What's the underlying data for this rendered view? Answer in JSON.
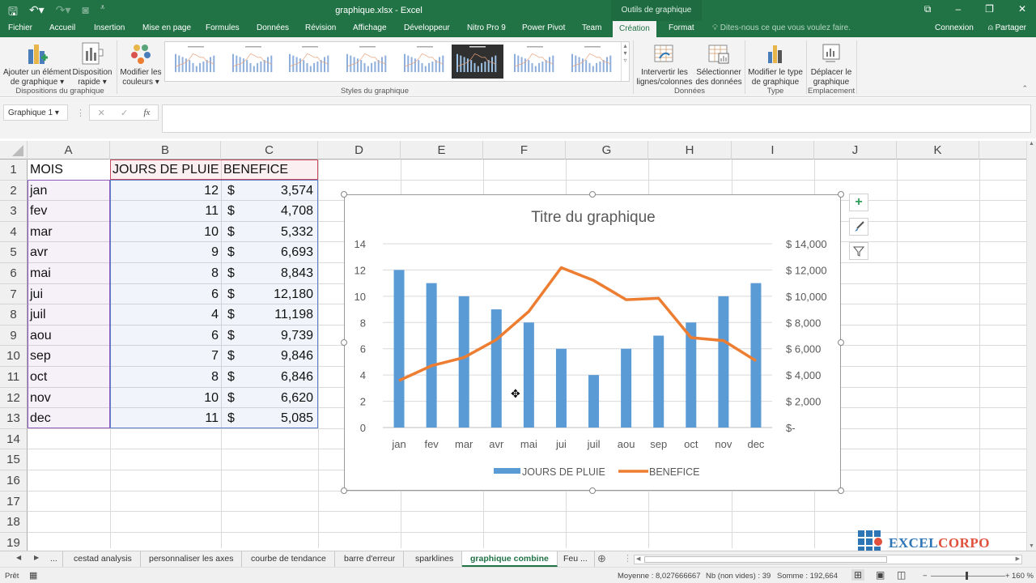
{
  "window": {
    "title": "graphique.xlsx - Excel",
    "context_group": "Outils de graphique"
  },
  "ribbon_tabs": [
    "Fichier",
    "Accueil",
    "Insertion",
    "Mise en page",
    "Formules",
    "Données",
    "Révision",
    "Affichage",
    "Développeur",
    "Nitro Pro 9",
    "Power Pivot",
    "Team",
    "Création",
    "Format"
  ],
  "active_tab": "Création",
  "tell_me": "Dites-nous ce que vous voulez faire.",
  "account": {
    "signin": "Connexion",
    "share": "Partager"
  },
  "ribbon": {
    "add_element": [
      "Ajouter un élément",
      "de graphique ▾"
    ],
    "quick_layout": [
      "Disposition",
      "rapide ▾"
    ],
    "change_colors": [
      "Modifier les",
      "couleurs ▾"
    ],
    "switch_row_col": [
      "Intervertir les",
      "lignes/colonnes"
    ],
    "select_data": [
      "Sélectionner",
      "des données"
    ],
    "change_type": [
      "Modifier le type",
      "de graphique"
    ],
    "move_chart": [
      "Déplacer le",
      "graphique"
    ],
    "groups": {
      "layouts": "Dispositions du graphique",
      "styles": "Styles du graphique",
      "data": "Données",
      "type": "Type",
      "location": "Emplacement"
    },
    "style_count": 8,
    "selected_style_index": 5
  },
  "formula_bar": {
    "name_box": "Graphique 1 ▾",
    "cancel": "✕",
    "enter": "✓",
    "fx": "fx",
    "value": ""
  },
  "columns": [
    "A",
    "B",
    "C",
    "D",
    "E",
    "F",
    "G",
    "H",
    "I",
    "J",
    "K"
  ],
  "rows": [
    "1",
    "2",
    "3",
    "4",
    "5",
    "6",
    "7",
    "8",
    "9",
    "10",
    "11",
    "12",
    "13",
    "14",
    "15",
    "16",
    "17",
    "18",
    "19"
  ],
  "sheet": {
    "headers": [
      "MOIS",
      "JOURS DE PLUIE",
      "BENEFICE"
    ],
    "data": [
      [
        "jan",
        "12",
        "$",
        "3,574"
      ],
      [
        "fev",
        "11",
        "$",
        "4,708"
      ],
      [
        "mar",
        "10",
        "$",
        "5,332"
      ],
      [
        "avr",
        "9",
        "$",
        "6,693"
      ],
      [
        "mai",
        "8",
        "$",
        "8,843"
      ],
      [
        "jui",
        "6",
        "$",
        "12,180"
      ],
      [
        "juil",
        "4",
        "$",
        "11,198"
      ],
      [
        "aou",
        "6",
        "$",
        "9,739"
      ],
      [
        "sep",
        "7",
        "$",
        "9,846"
      ],
      [
        "oct",
        "8",
        "$",
        "6,846"
      ],
      [
        "nov",
        "10",
        "$",
        "6,620"
      ],
      [
        "dec",
        "11",
        "$",
        "5,085"
      ]
    ]
  },
  "chart_data": {
    "type": "bar+line",
    "title": "Titre du graphique",
    "categories": [
      "jan",
      "fev",
      "mar",
      "avr",
      "mai",
      "jui",
      "juil",
      "aou",
      "sep",
      "oct",
      "nov",
      "dec"
    ],
    "series": [
      {
        "name": "JOURS DE PLUIE",
        "type": "bar",
        "axis": "left",
        "color": "#5b9bd5",
        "values": [
          12,
          11,
          10,
          9,
          8,
          6,
          4,
          6,
          7,
          8,
          10,
          11
        ]
      },
      {
        "name": "BENEFICE",
        "type": "line",
        "axis": "right",
        "color": "#ed7d31",
        "values": [
          3574,
          4708,
          5332,
          6693,
          8843,
          12180,
          11198,
          9739,
          9846,
          6846,
          6620,
          5085
        ]
      }
    ],
    "y_left": {
      "min": 0,
      "max": 14,
      "step": 2,
      "ticks": [
        "0",
        "2",
        "4",
        "6",
        "8",
        "10",
        "12",
        "14"
      ]
    },
    "y_right": {
      "min": 0,
      "max": 14000,
      "step": 2000,
      "ticks": [
        "$-",
        "$ 2,000",
        "$ 4,000",
        "$ 6,000",
        "$ 8,000",
        "$ 10,000",
        "$ 12,000",
        "$ 14,000"
      ]
    },
    "grid": true,
    "legend": "bottom"
  },
  "chart_side_buttons": [
    "chart-elements",
    "chart-styles",
    "chart-filters"
  ],
  "sheet_tabs": [
    "cestad analysis",
    "personnaliser les axes",
    "courbe de tendance",
    "barre d'erreur",
    "sparklines",
    "graphique combine",
    "Feu ..."
  ],
  "active_sheet": "graphique combine",
  "status": {
    "ready": "Prêt",
    "average": "Moyenne : 8,027666667",
    "count": "Nb (non vides) : 39",
    "sum": "Somme : 192,664",
    "zoom": "160 %"
  },
  "watermark": {
    "part1": "EXCEL",
    "part2": "CORPO"
  }
}
